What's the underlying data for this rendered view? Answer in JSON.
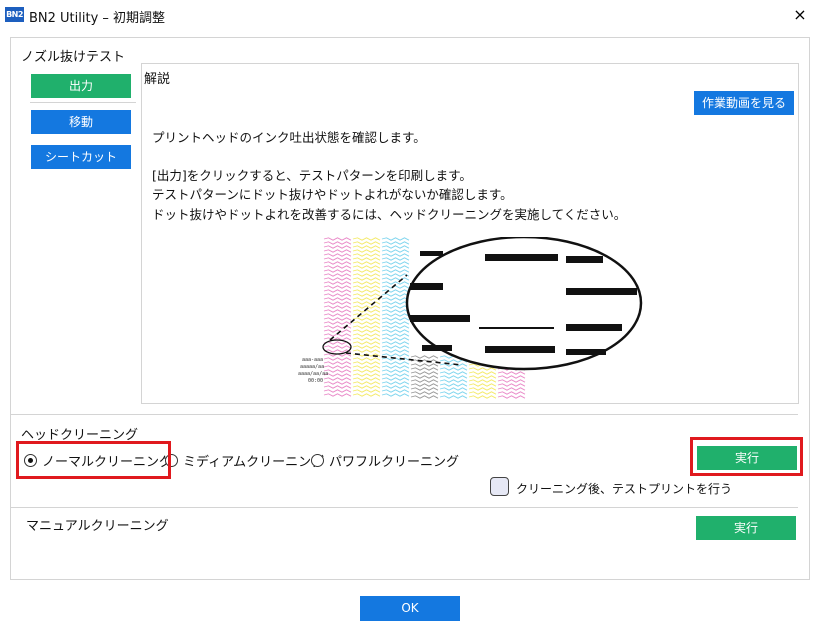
{
  "window": {
    "logo_text": "BN2",
    "title": "BN2 Utility – 初期調整",
    "close_symbol": "×"
  },
  "nozzle_test": {
    "section_label": "ノズル抜けテスト",
    "buttons": {
      "output": "出力",
      "move": "移動",
      "sheet_cut": "シートカット"
    }
  },
  "description": {
    "title": "解説",
    "video_button": "作業動画を見る",
    "lines": [
      "プリントヘッドのインク吐出状態を確認します。",
      "[出力]をクリックすると、テストパターンを印刷します。",
      "テストパターンにドット抜けやドットよれがないか確認します。",
      "ドット抜けやドットよれを改善するには、ヘッドクリーニングを実施してください。"
    ],
    "illustration": {
      "printed_label_lines": [
        "aaa-aaa",
        "aaaaa/aa",
        "aaaa/aa/aa",
        "00:00"
      ],
      "stripe_colors": [
        "#e98ac8",
        "#f4ea6a",
        "#7fd5ee",
        "#9a9a9a",
        "#7fd5ee",
        "#f4ea6a",
        "#e98ac8"
      ]
    }
  },
  "head_cleaning": {
    "section_label": "ヘッドクリーニング",
    "options": [
      {
        "label": "ノーマルクリーニング",
        "selected": true
      },
      {
        "label": "ミディアムクリーニング",
        "selected": false
      },
      {
        "label": "パワフルクリーニング",
        "selected": false
      }
    ],
    "run_button": "実行",
    "test_print_checkbox": {
      "label": "クリーニング後、テストプリントを行う",
      "checked": false
    },
    "highlight_color": "#e0191e"
  },
  "manual_cleaning": {
    "section_label": "マニュアルクリーニング",
    "run_button": "実行"
  },
  "footer": {
    "ok_button": "OK"
  },
  "colors": {
    "green": "#20b06c",
    "blue": "#1478e0"
  }
}
